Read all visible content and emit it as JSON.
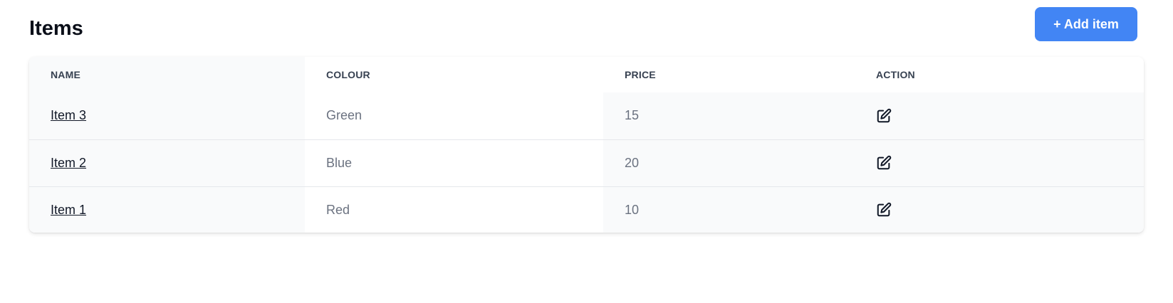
{
  "header": {
    "title": "Items",
    "add_button_label": "+ Add item"
  },
  "table": {
    "columns": [
      "NAME",
      "COLOUR",
      "PRICE",
      "ACTION"
    ],
    "rows": [
      {
        "name": "Item 3",
        "colour": "Green",
        "price": "15",
        "action_icon": "edit-icon"
      },
      {
        "name": "Item 2",
        "colour": "Blue",
        "price": "20",
        "action_icon": "edit-icon"
      },
      {
        "name": "Item 1",
        "colour": "Red",
        "price": "10",
        "action_icon": "edit-icon"
      }
    ]
  },
  "colors": {
    "accent": "#4285f4",
    "header_text": "#374151",
    "cell_text": "#6b7280",
    "shaded_column": "#f9fafb"
  }
}
